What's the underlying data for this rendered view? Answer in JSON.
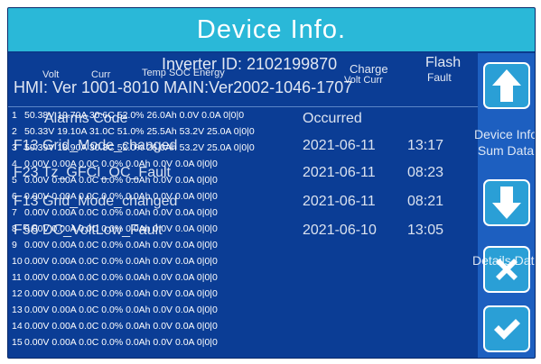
{
  "title": "Device Info.",
  "inverter_id": "Inverter ID: 2102199870",
  "hmi_version": "HMI: Ver 1001-8010  MAIN:Ver2002-1046-1707",
  "headers": {
    "volt": "Volt",
    "curr": "Curr",
    "temp_soc_energy": "Temp SOC Energy",
    "charge": "Charge",
    "volt_curr": "Volt Curr",
    "flash": "Flash",
    "fault": "Fault"
  },
  "alarms": {
    "code_label": "Alarms Code",
    "occurred_label": "Occurred"
  },
  "alarm_entries": [
    {
      "code": "F13 Grid_Mode_changed",
      "date": "2021-06-11",
      "time": "13:17"
    },
    {
      "code": "F23 Tz_GFCI_OC_Fault",
      "date": "2021-06-11",
      "time": "08:23"
    },
    {
      "code": "F13 Grid_Mode_changed",
      "date": "2021-06-11",
      "time": "08:21"
    },
    {
      "code": "F56 DC_VoltLow_Fault",
      "date": "2021-06-10",
      "time": "13:05"
    }
  ],
  "battery_rows": [
    {
      "n": "1",
      "text": "50.38V 19.70A 30.6C 52.0% 26.0Ah 0.0V 0.0A 0|0|0"
    },
    {
      "n": "2",
      "text": "50.33V 19.10A 31.0C 51.0% 25.5Ah 53.2V 25.0A 0|0|0"
    },
    {
      "n": "3",
      "text": "50.39V 18.90A 30.3C 52.0% 26.0Ah 53.2V 25.0A 0|0|0"
    },
    {
      "n": "4",
      "text": "0.00V 0.00A 0.0C 0.0% 0.0Ah 0.0V 0.0A 0|0|0"
    },
    {
      "n": "5",
      "text": "0.00V 0.00A 0.0C 0.0% 0.0Ah 0.0V 0.0A 0|0|0"
    },
    {
      "n": "6",
      "text": "0.00V 0.00A 0.0C 0.0% 0.0Ah 0.0V 0.0A 0|0|0"
    },
    {
      "n": "7",
      "text": "0.00V 0.00A 0.0C 0.0% 0.0Ah 0.0V 0.0A 0|0|0"
    },
    {
      "n": "8",
      "text": "0.00V 0.00A 0.0C 0.0% 0.0Ah 0.0V 0.0A 0|0|0"
    },
    {
      "n": "9",
      "text": "0.00V 0.00A 0.0C 0.0% 0.0Ah 0.0V 0.0A 0|0|0"
    },
    {
      "n": "10",
      "text": "0.00V 0.00A 0.0C 0.0% 0.0Ah 0.0V 0.0A 0|0|0"
    },
    {
      "n": "11",
      "text": "0.00V 0.00A 0.0C 0.0% 0.0Ah 0.0V 0.0A 0|0|0"
    },
    {
      "n": "12",
      "text": "0.00V 0.00A 0.0C 0.0% 0.0Ah 0.0V 0.0A 0|0|0"
    },
    {
      "n": "13",
      "text": "0.00V 0.00A 0.0C 0.0% 0.0Ah 0.0V 0.0A 0|0|0"
    },
    {
      "n": "14",
      "text": "0.00V 0.00A 0.0C 0.0% 0.0Ah 0.0V 0.0A 0|0|0"
    },
    {
      "n": "15",
      "text": "0.00V 0.00A 0.0C 0.0% 0.0Ah 0.0V 0.0A 0|0|0"
    }
  ],
  "sidebar": {
    "device_info": "Device Info",
    "sum_data": "Sum Data",
    "details_data": "Details Data"
  },
  "icons": {
    "up": "arrow-up-icon",
    "down": "arrow-down-icon",
    "close": "close-icon",
    "confirm": "check-icon"
  },
  "colors": {
    "title_bar": "#2ab8d8",
    "panel": "#0b3d95",
    "sidebar": "#1d5fc0",
    "button": "#2a9fd6"
  }
}
